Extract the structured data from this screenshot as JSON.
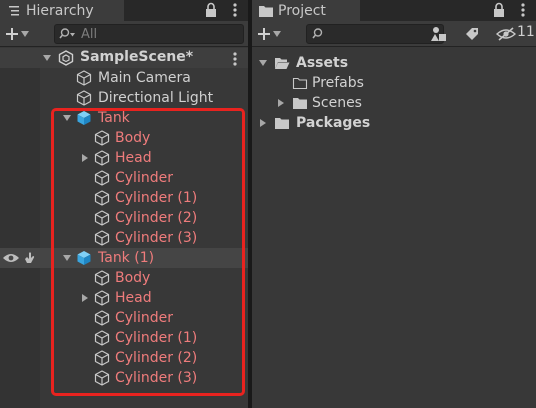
{
  "hierarchy": {
    "tab_label": "Hierarchy",
    "search_placeholder": "All",
    "scene_name": "SampleScene*",
    "items": [
      {
        "label": "Main Camera"
      },
      {
        "label": "Directional Light"
      },
      {
        "label": "Tank"
      },
      {
        "label": "Body"
      },
      {
        "label": "Head"
      },
      {
        "label": "Cylinder"
      },
      {
        "label": "Cylinder (1)"
      },
      {
        "label": "Cylinder (2)"
      },
      {
        "label": "Cylinder (3)"
      },
      {
        "label": "Tank (1)"
      },
      {
        "label": "Body"
      },
      {
        "label": "Head"
      },
      {
        "label": "Cylinder"
      },
      {
        "label": "Cylinder (1)"
      },
      {
        "label": "Cylinder (2)"
      },
      {
        "label": "Cylinder (3)"
      }
    ]
  },
  "project": {
    "tab_label": "Project",
    "hidden_count": "11",
    "tree": [
      {
        "label": "Assets"
      },
      {
        "label": "Prefabs"
      },
      {
        "label": "Scenes"
      },
      {
        "label": "Packages"
      }
    ]
  },
  "colors": {
    "prefab_text": "#ef7c7c",
    "selection_outline": "#e8231f",
    "prefab_icon": "#4fb3ea"
  }
}
